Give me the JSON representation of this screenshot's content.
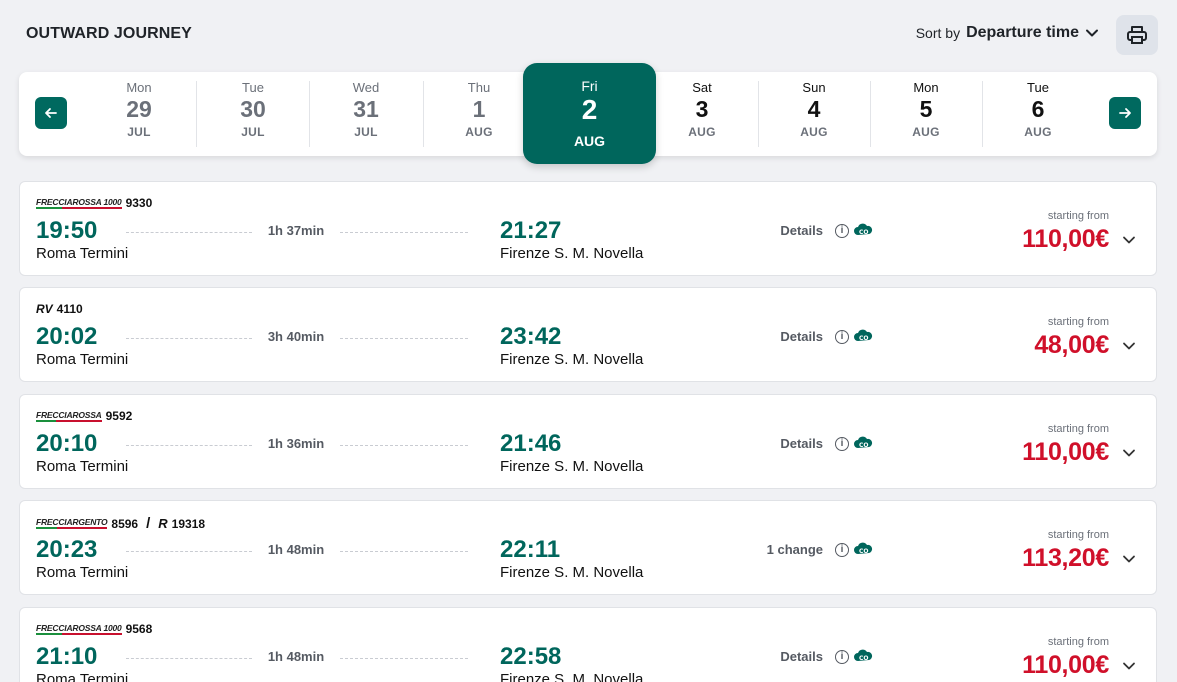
{
  "header": {
    "title": "OUTWARD JOURNEY",
    "sort_label": "Sort by",
    "sort_value": "Departure time",
    "print_icon": "printer-icon"
  },
  "dates": [
    {
      "dow": "Mon",
      "num": "29",
      "mon": "JUL",
      "state": "past"
    },
    {
      "dow": "Tue",
      "num": "30",
      "mon": "JUL",
      "state": "past"
    },
    {
      "dow": "Wed",
      "num": "31",
      "mon": "JUL",
      "state": "past"
    },
    {
      "dow": "Thu",
      "num": "1",
      "mon": "AUG",
      "state": "past"
    },
    {
      "dow": "Fri",
      "num": "2",
      "mon": "AUG",
      "state": "selected"
    },
    {
      "dow": "Sat",
      "num": "3",
      "mon": "AUG",
      "state": "future"
    },
    {
      "dow": "Sun",
      "num": "4",
      "mon": "AUG",
      "state": "future"
    },
    {
      "dow": "Mon",
      "num": "5",
      "mon": "AUG",
      "state": "future"
    },
    {
      "dow": "Tue",
      "num": "6",
      "mon": "AUG",
      "state": "future"
    }
  ],
  "colors": {
    "accent": "#00665c",
    "price": "#d0102a",
    "background": "#f0f1f4"
  },
  "starting_from_label": "starting from",
  "solutions": [
    {
      "trains": [
        {
          "brand": "FRECCIAROSSA 1000",
          "number": "9330",
          "kind": "fr"
        }
      ],
      "dep_time": "19:50",
      "dep_station": "Roma Termini",
      "duration": "1h 37min",
      "arr_time": "21:27",
      "arr_station": "Firenze S. M. Novella",
      "details": "Details",
      "price": "110,00€"
    },
    {
      "trains": [
        {
          "brand": "RV",
          "number": "4110",
          "kind": "rv"
        }
      ],
      "dep_time": "20:02",
      "dep_station": "Roma Termini",
      "duration": "3h 40min",
      "arr_time": "23:42",
      "arr_station": "Firenze S. M. Novella",
      "details": "Details",
      "price": "48,00€"
    },
    {
      "trains": [
        {
          "brand": "FRECCIAROSSA",
          "number": "9592",
          "kind": "fr"
        }
      ],
      "dep_time": "20:10",
      "dep_station": "Roma Termini",
      "duration": "1h 36min",
      "arr_time": "21:46",
      "arr_station": "Firenze S. M. Novella",
      "details": "Details",
      "price": "110,00€"
    },
    {
      "trains": [
        {
          "brand": "FRECCIARGENTO",
          "number": "8596",
          "kind": "fr"
        },
        {
          "brand": "R",
          "number": "19318",
          "kind": "r"
        }
      ],
      "dep_time": "20:23",
      "dep_station": "Roma Termini",
      "duration": "1h 48min",
      "arr_time": "22:11",
      "arr_station": "Firenze S. M. Novella",
      "details": "1 change",
      "price": "113,20€"
    },
    {
      "trains": [
        {
          "brand": "FRECCIAROSSA 1000",
          "number": "9568",
          "kind": "fr"
        }
      ],
      "dep_time": "21:10",
      "dep_station": "Roma Termini",
      "duration": "1h 48min",
      "arr_time": "22:58",
      "arr_station": "Firenze S. M. Novella",
      "details": "Details",
      "price": "110,00€"
    }
  ]
}
